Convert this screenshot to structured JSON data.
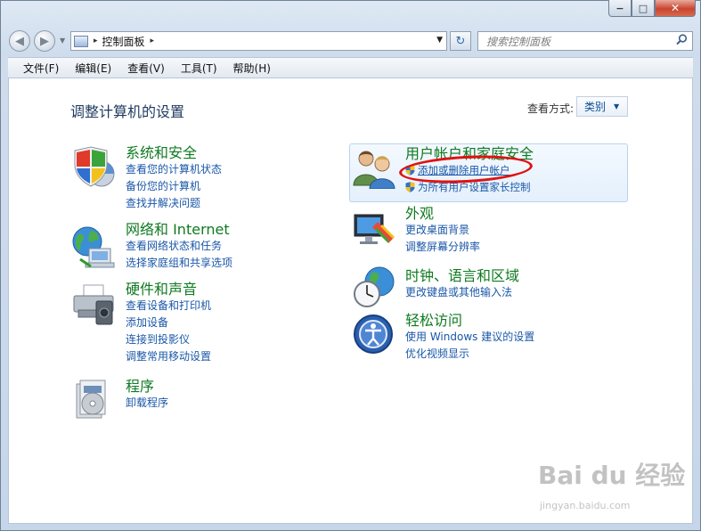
{
  "window": {
    "caption_buttons": {
      "minimize": "−",
      "maximize": "□",
      "close": "✕"
    }
  },
  "navigation": {
    "back_glyph": "◀",
    "forward_glyph": "▶",
    "history_glyph": "▼",
    "address": {
      "breadcrumb": "控制面板",
      "separator": "▸",
      "dropdown": "▼"
    },
    "refresh_glyph": "↻",
    "search": {
      "placeholder": "搜索控制面板",
      "icon": "search-icon"
    }
  },
  "menu": {
    "items": [
      {
        "label": "文件(F)"
      },
      {
        "label": "编辑(E)"
      },
      {
        "label": "查看(V)"
      },
      {
        "label": "工具(T)"
      },
      {
        "label": "帮助(H)"
      }
    ]
  },
  "main": {
    "title": "调整计算机的设置",
    "view_by_label": "查看方式:",
    "view_by_value": "类别",
    "view_by_arrow": "▼",
    "left_categories": [
      {
        "heading": "系统和安全",
        "icon": "system-security-icon",
        "links": [
          "查看您的计算机状态",
          "备份您的计算机",
          "查找并解决问题"
        ]
      },
      {
        "heading": "网络和 Internet",
        "icon": "network-globe-icon",
        "links": [
          "查看网络状态和任务",
          "选择家庭组和共享选项"
        ]
      },
      {
        "heading": "硬件和声音",
        "icon": "printer-icon",
        "links": [
          "查看设备和打印机",
          "添加设备",
          "连接到投影仪",
          "调整常用移动设置"
        ]
      },
      {
        "heading": "程序",
        "icon": "programs-icon",
        "links": [
          "卸载程序"
        ]
      }
    ],
    "right_categories": [
      {
        "heading": "用户帐户和家庭安全",
        "icon": "users-icon",
        "links": [
          "添加或删除用户帐户",
          "为所有用户设置家长控制"
        ]
      },
      {
        "heading": "外观",
        "icon": "monitor-palette-icon",
        "links": [
          "更改桌面背景",
          "调整屏幕分辨率"
        ]
      },
      {
        "heading": "时钟、语言和区域",
        "icon": "clock-globe-icon",
        "links": [
          "更改键盘或其他输入法"
        ]
      },
      {
        "heading": "轻松访问",
        "icon": "ease-of-access-icon",
        "links": [
          "使用 Windows 建议的设置",
          "优化视频显示"
        ]
      }
    ]
  },
  "watermark": {
    "logo": "Bai du 经验",
    "url": "jingyan.baidu.com"
  },
  "colors": {
    "heading": "#0f7a20",
    "link": "#1a57a8",
    "annotation": "#e01111"
  }
}
